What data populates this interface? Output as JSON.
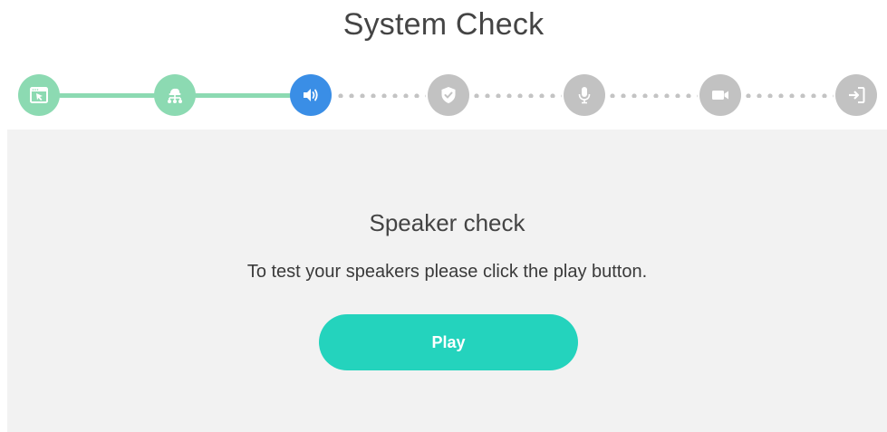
{
  "page": {
    "title": "System Check"
  },
  "stepper": {
    "steps": [
      {
        "name": "browser",
        "icon": "browser-cursor-icon",
        "status": "done"
      },
      {
        "name": "network",
        "icon": "network-icon",
        "status": "done"
      },
      {
        "name": "speaker",
        "icon": "speaker-icon",
        "status": "active"
      },
      {
        "name": "security",
        "icon": "shield-check-icon",
        "status": "pending"
      },
      {
        "name": "microphone",
        "icon": "microphone-icon",
        "status": "pending"
      },
      {
        "name": "camera",
        "icon": "video-camera-icon",
        "status": "pending"
      },
      {
        "name": "enter",
        "icon": "sign-in-icon",
        "status": "pending"
      }
    ]
  },
  "panel": {
    "heading": "Speaker check",
    "description": "To test your speakers please click the play button.",
    "play_label": "Play"
  },
  "colors": {
    "done": "#8cdab2",
    "active": "#3a8ee6",
    "pending": "#c2c2c2",
    "button": "#24d3bd",
    "panel_bg": "#f2f2f2"
  }
}
